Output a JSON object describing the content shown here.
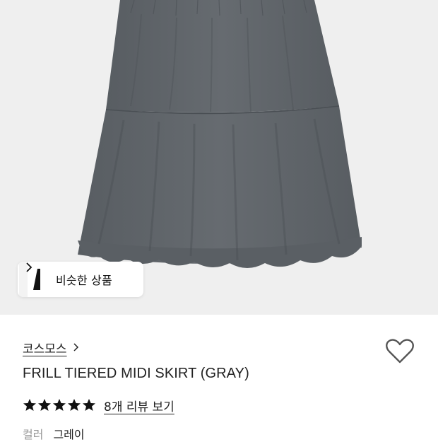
{
  "similar": {
    "label": "비슷한 상품"
  },
  "brand": {
    "name": "코스모스"
  },
  "product": {
    "name": "FRILL TIERED MIDI SKIRT (GRAY)"
  },
  "rating": {
    "stars": 5,
    "max": 5,
    "review_link": "8개 리뷰 보기"
  },
  "options": [
    {
      "label": "컬러",
      "value": "그레이"
    }
  ],
  "colors": {
    "skirt": "#5f6469",
    "background": "#efefef",
    "star": "#111111"
  }
}
